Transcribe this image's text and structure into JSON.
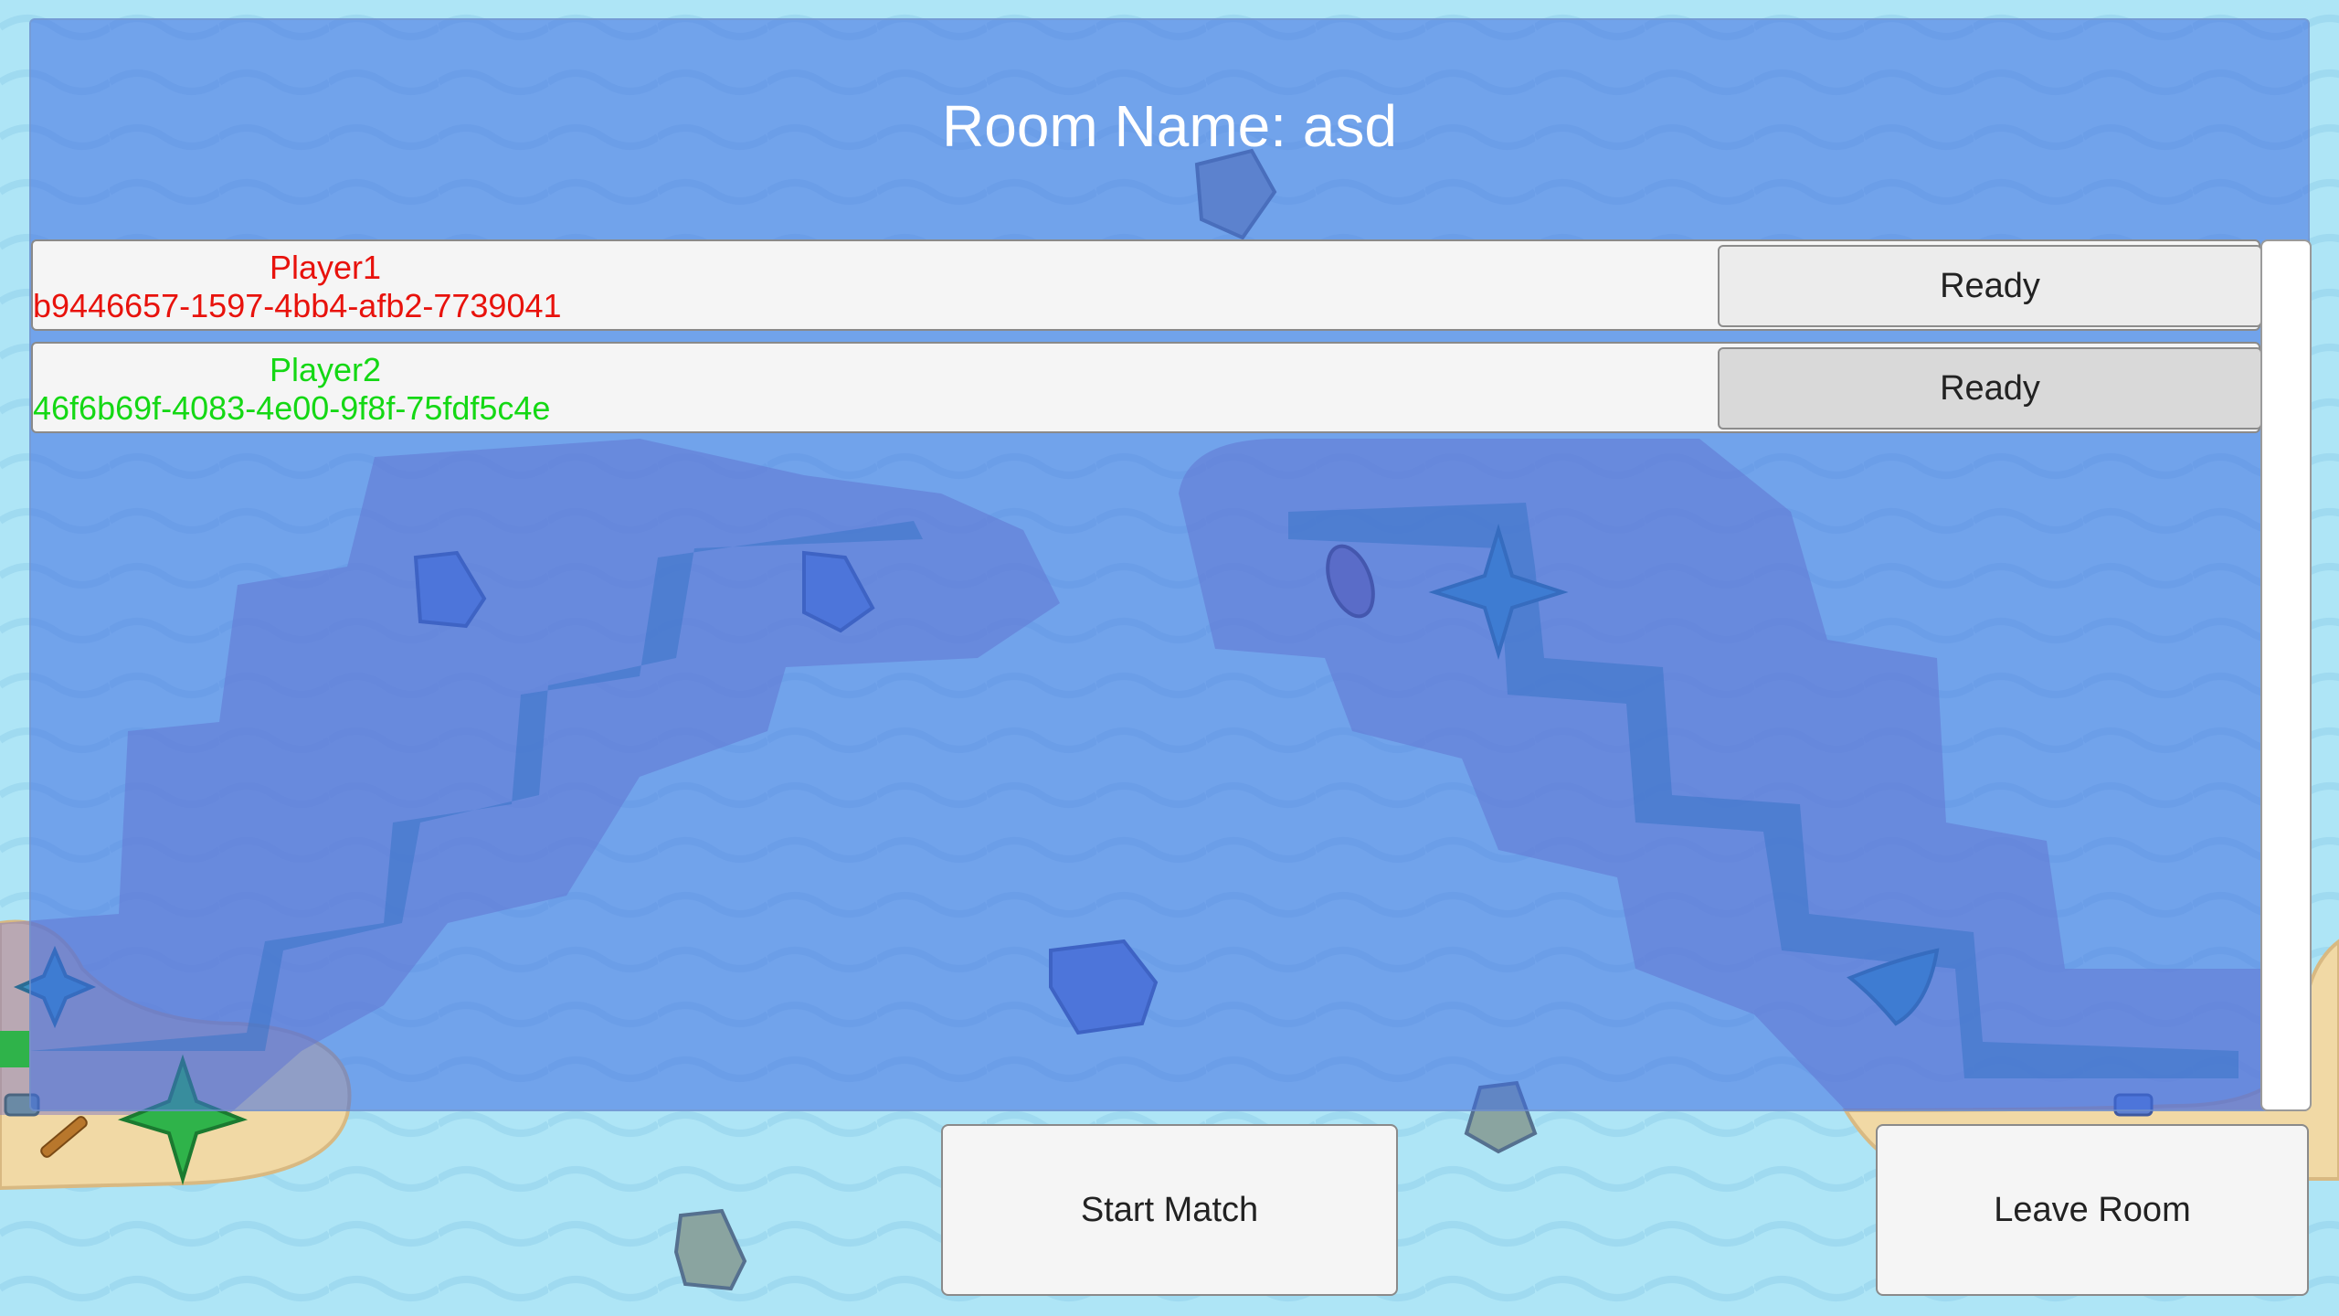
{
  "room": {
    "title": "Room Name: asd"
  },
  "players": [
    {
      "name": "Player1",
      "id": "b9446657-1597-4bb4-afb2-7739041",
      "color": "#e8120c",
      "ready_label": "Ready"
    },
    {
      "name": "Player2",
      "id": "46f6b69f-4083-4e00-9f8f-75fdf5c4e",
      "color": "#14d814",
      "ready_label": "Ready"
    }
  ],
  "actions": {
    "start_label": "Start Match",
    "leave_label": "Leave Room"
  },
  "colors": {
    "ocean": "#aee5f6",
    "panel_tint": "#406ee1",
    "island_shallow": "#9590c8",
    "island_deep": "#3d8bb0",
    "sand": "#f1d9a5",
    "palm": "#2fb34a",
    "rock": "#7f9bb5"
  },
  "icons": [
    "rock-icon",
    "palm-tree-icon",
    "boat-icon",
    "driftwood-icon"
  ]
}
